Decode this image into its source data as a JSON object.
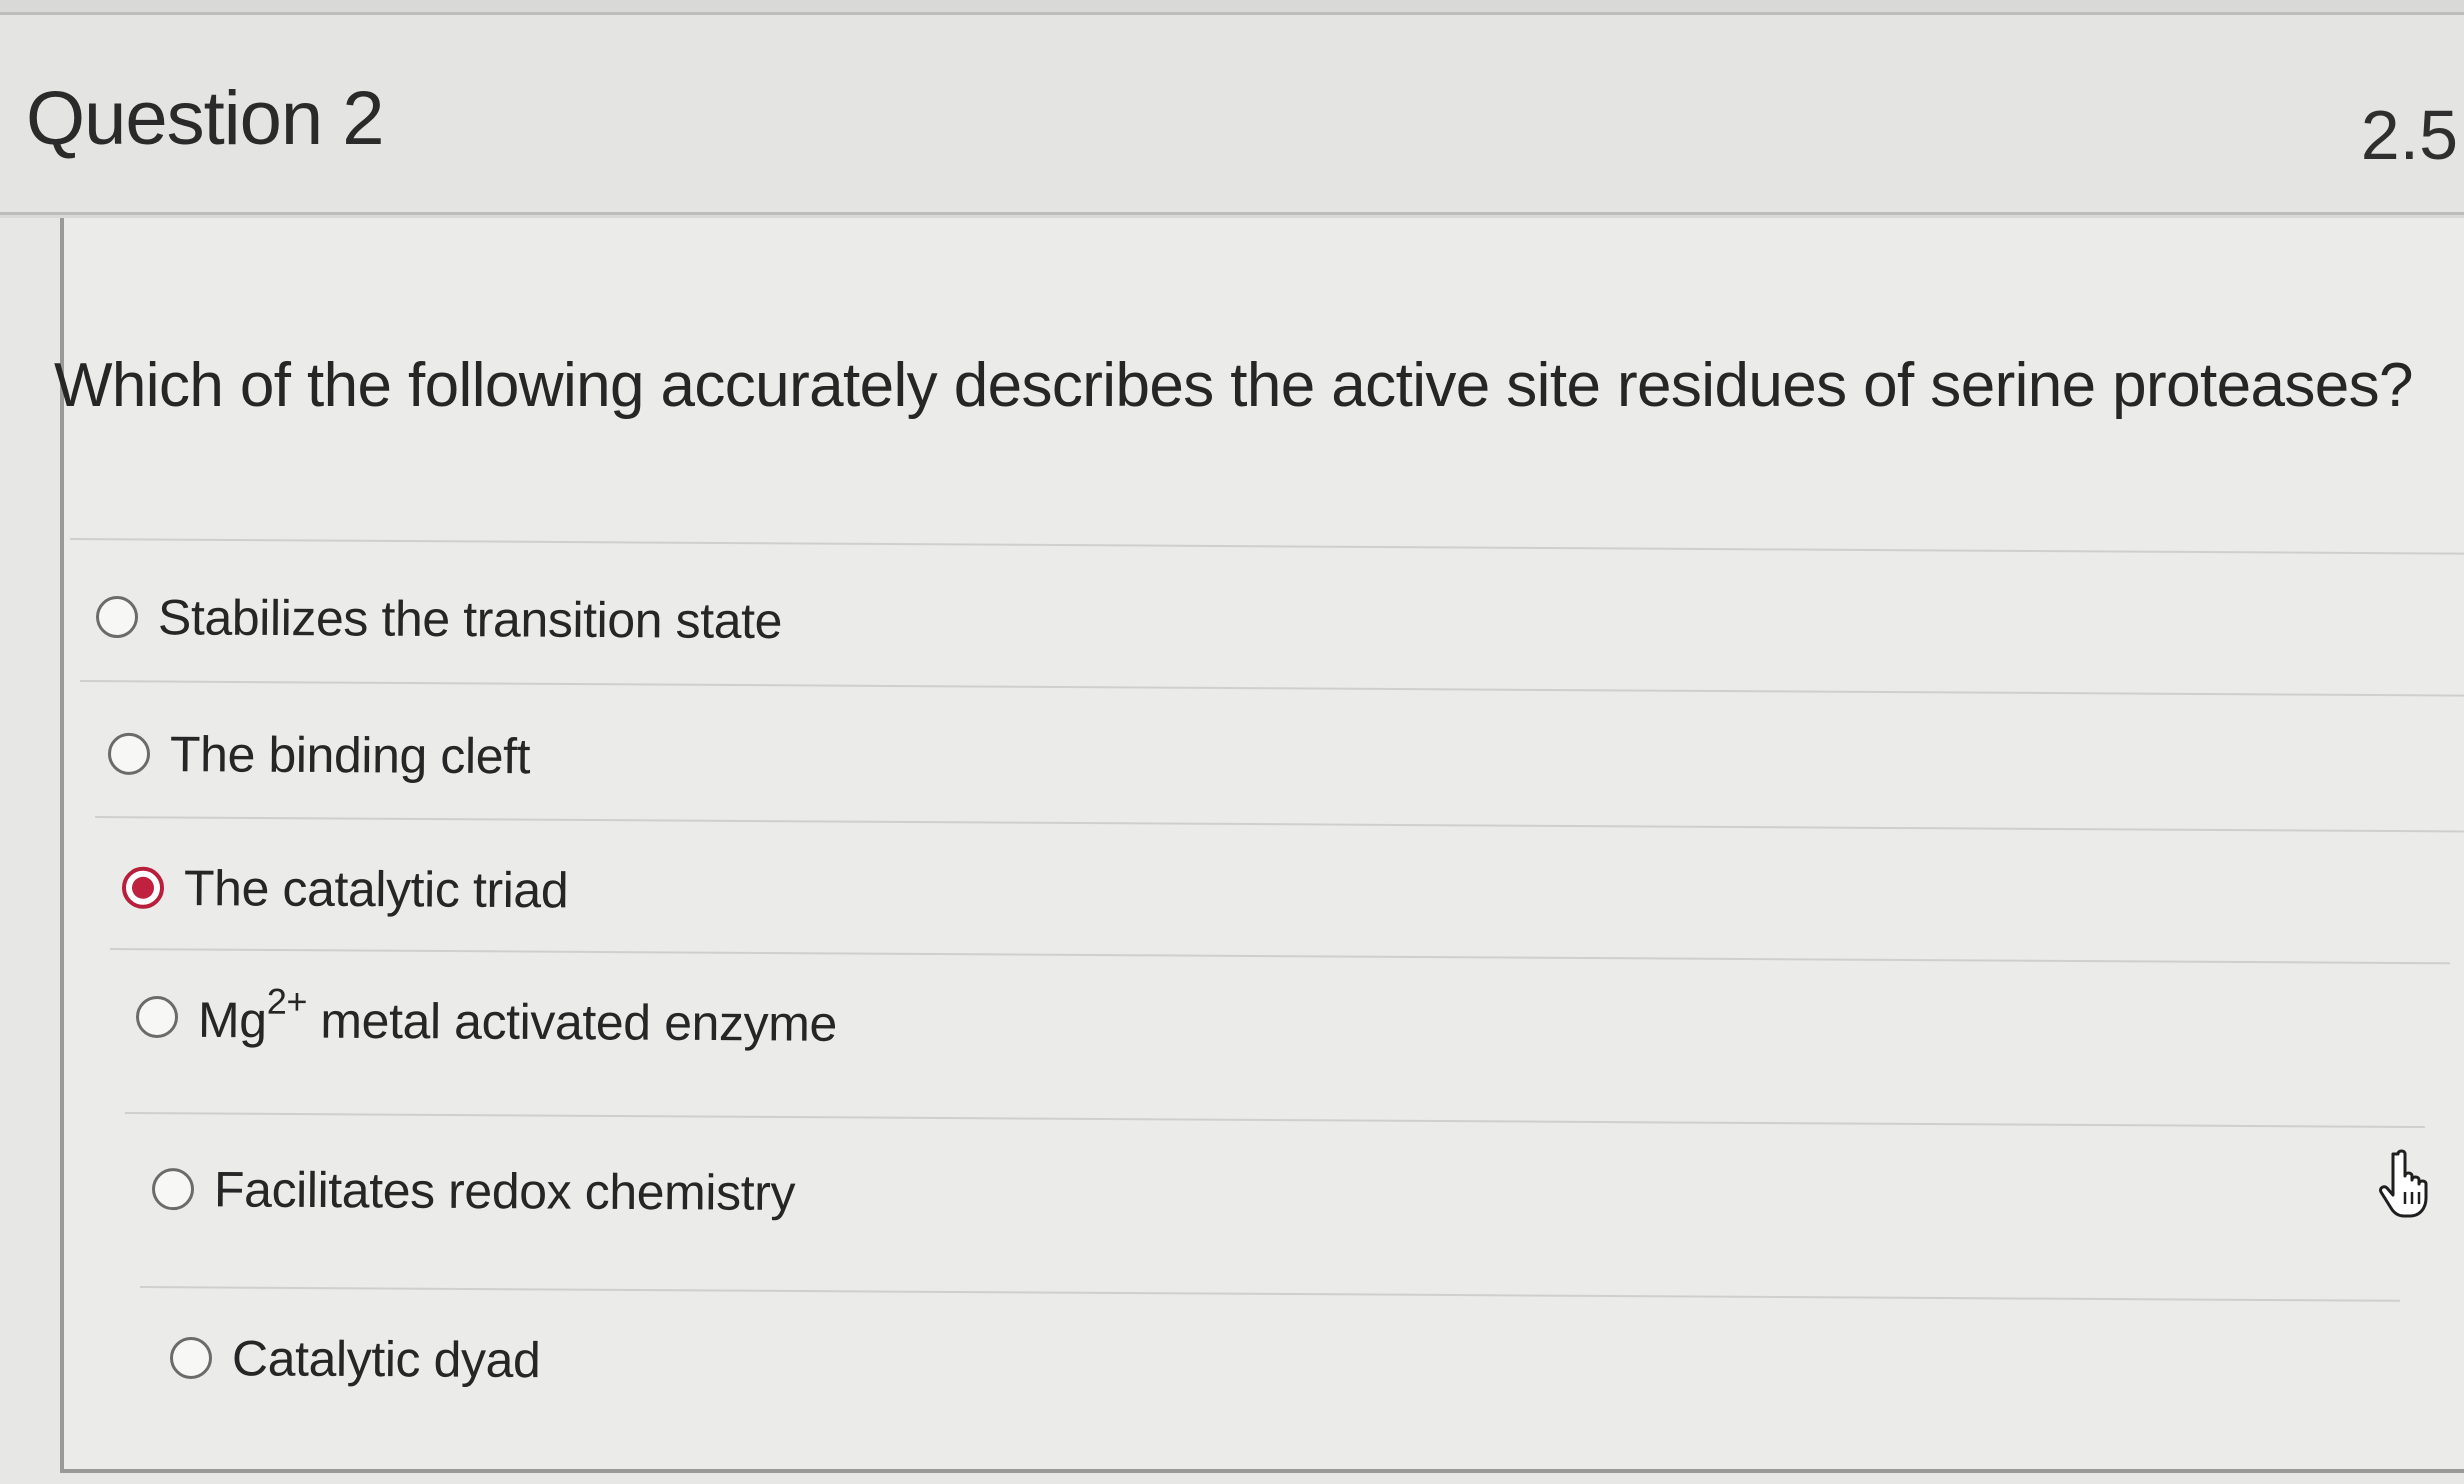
{
  "question": {
    "title": "Question 2",
    "points": "2.5",
    "prompt": "Which of the following accurately describes the active site residues of serine proteases?"
  },
  "answers": [
    {
      "label": "Stabilizes the transition state",
      "selected": false
    },
    {
      "label": "The binding cleft",
      "selected": false
    },
    {
      "label": "The catalytic triad",
      "selected": true
    },
    {
      "label_prefix": "Mg",
      "superscript": "2+",
      "label_suffix": " metal activated enzyme",
      "selected": false
    },
    {
      "label": "Facilitates redox chemistry",
      "selected": false
    },
    {
      "label": "Catalytic dyad",
      "selected": false
    }
  ],
  "cursor": {
    "icon": "hand-pointer-icon"
  },
  "colors": {
    "selected_radio": "#c0213f",
    "background": "#e7e7e6",
    "text": "#262626"
  }
}
